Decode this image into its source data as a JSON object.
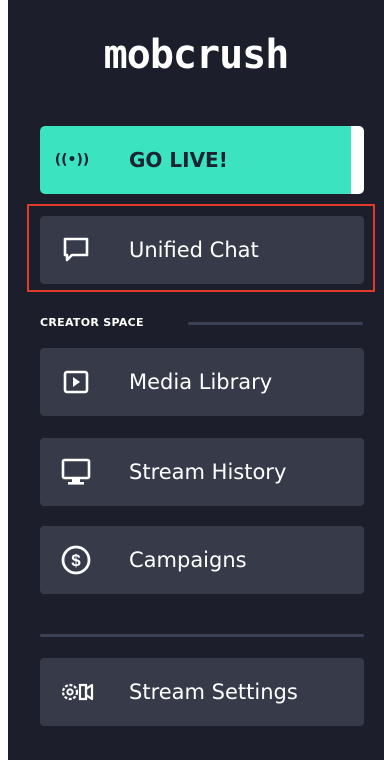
{
  "brand": {
    "logo_text": "mobcrush"
  },
  "nav": {
    "go_live": {
      "label": "GO LIVE!",
      "icon": "broadcast-icon",
      "icon_glyph": "((•))"
    },
    "unified_chat": {
      "label": "Unified Chat",
      "icon": "chat-bubble-icon"
    },
    "section_title": "CREATOR SPACE",
    "media_library": {
      "label": "Media Library",
      "icon": "play-square-icon"
    },
    "stream_history": {
      "label": "Stream History",
      "icon": "monitor-icon"
    },
    "campaigns": {
      "label": "Campaigns",
      "icon": "dollar-circle-icon"
    },
    "stream_settings": {
      "label": "Stream Settings",
      "icon": "gear-camera-icon"
    }
  },
  "colors": {
    "panel_bg": "#1c1f2b",
    "button_bg": "#363a49",
    "accent_live": "#3be3c0",
    "highlight_border": "#e03a2b"
  }
}
